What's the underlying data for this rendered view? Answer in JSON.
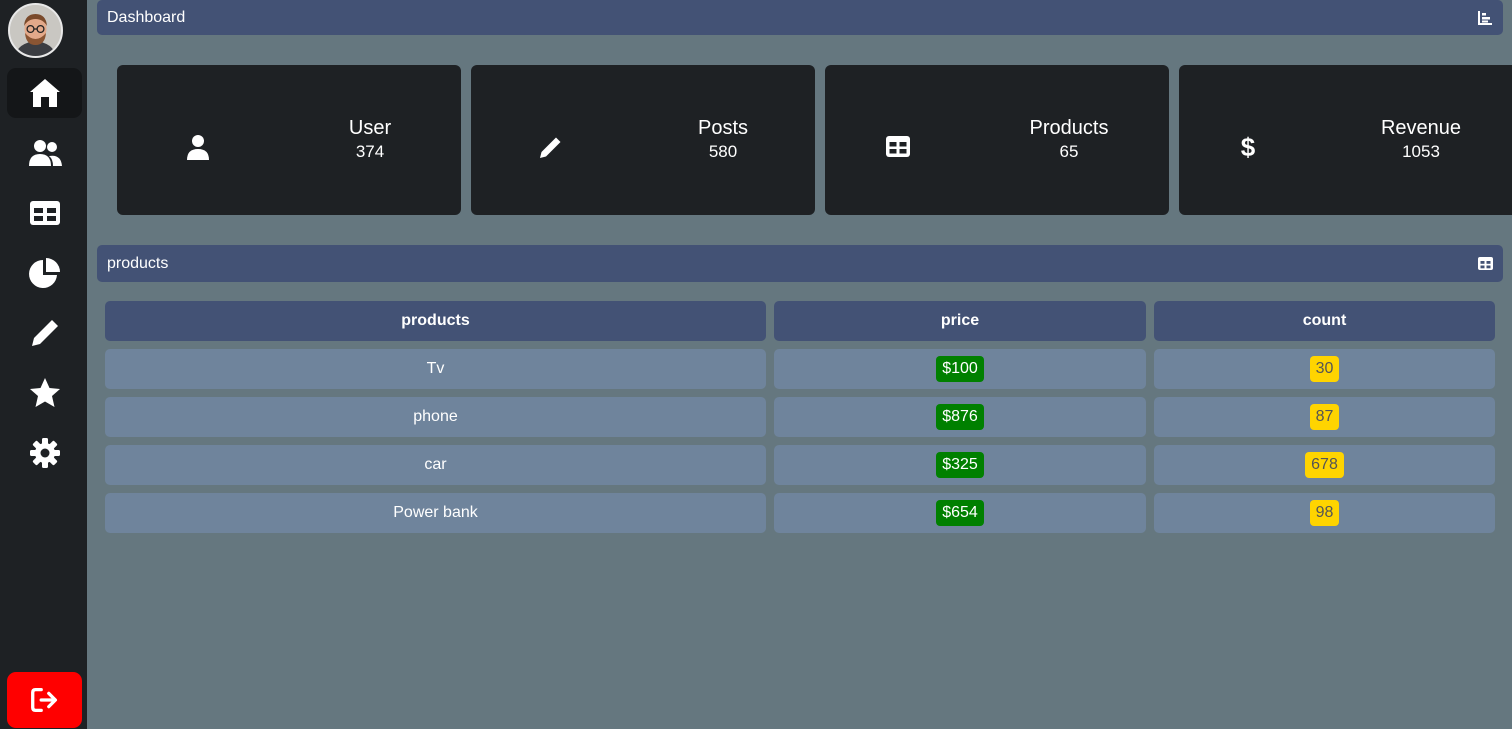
{
  "header": {
    "title": "Dashboard",
    "icon": "chart-icon"
  },
  "sidebar": {
    "items": [
      {
        "name": "home",
        "icon": "home-icon"
      },
      {
        "name": "users",
        "icon": "users-icon"
      },
      {
        "name": "table",
        "icon": "table-icon"
      },
      {
        "name": "charts",
        "icon": "pie-chart-icon"
      },
      {
        "name": "posts",
        "icon": "pencil-icon"
      },
      {
        "name": "favorites",
        "icon": "star-icon"
      },
      {
        "name": "settings",
        "icon": "gear-icon"
      }
    ],
    "logout_icon": "logout-icon"
  },
  "cards": [
    {
      "title": "User",
      "value": "374",
      "icon": "user-icon"
    },
    {
      "title": "Posts",
      "value": "580",
      "icon": "pencil-icon"
    },
    {
      "title": "Products",
      "value": "65",
      "icon": "table-icon"
    },
    {
      "title": "Revenue",
      "value": "1053",
      "icon": "dollar-icon"
    }
  ],
  "products_section": {
    "title": "products",
    "icon": "table-icon"
  },
  "table": {
    "headers": [
      "products",
      "price",
      "count"
    ],
    "rows": [
      {
        "product": "Tv",
        "price": "$100",
        "count": "30"
      },
      {
        "product": "phone",
        "price": "$876",
        "count": "87"
      },
      {
        "product": "car",
        "price": "$325",
        "count": "678"
      },
      {
        "product": "Power bank",
        "price": "$654",
        "count": "98"
      }
    ]
  },
  "colors": {
    "accent": "#435275",
    "background": "#65777f",
    "sidebar": "#1e2124",
    "price_badge": "#008000",
    "count_badge": "#ffd400",
    "logout": "#ff0000"
  }
}
